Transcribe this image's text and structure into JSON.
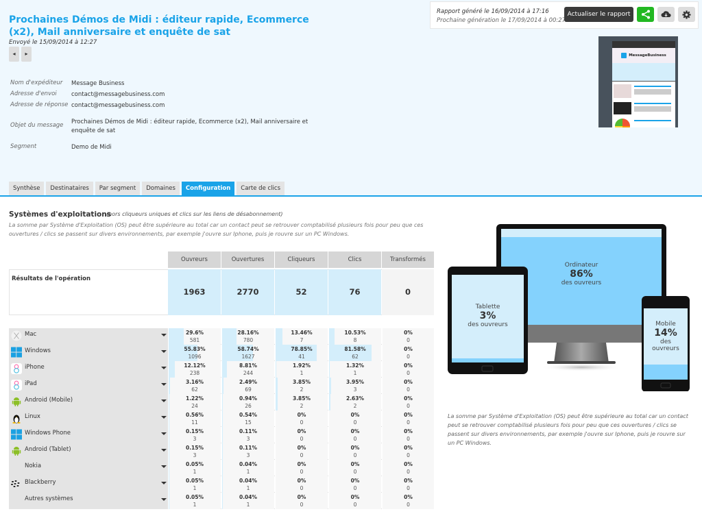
{
  "header": {
    "title": "Prochaines Démos de Midi : éditeur rapide, Ecommerce (x2), Mail anniversaire et enquête de sat",
    "sent": "Envoyé le 15/09/2014 à 12:27",
    "prev_icon": "◂",
    "next_icon": "▸",
    "info": [
      {
        "label": "Nom d'expéditeur",
        "value": "Message Business"
      },
      {
        "label": "Adresse d'envoi",
        "value": "contact@messagebusiness.com"
      },
      {
        "label": "Adresse de réponse",
        "value": "contact@messagebusiness.com"
      },
      {
        "label": "Objet du message",
        "value": "Prochaines Démos de Midi : éditeur rapide, Ecommerce (x2), Mail anniversaire et enquête de sat"
      },
      {
        "label": "Segment",
        "value": "Demo de Midi"
      }
    ]
  },
  "report": {
    "generated": "Rapport généré le 16/09/2014 à 17:16",
    "next": "Prochaine génération le 17/09/2014 à 00:27",
    "refresh_label": "Actualiser le rapport",
    "share_color": "#22b822",
    "thumbnail_brand": "MessageBusiness"
  },
  "tabs": [
    {
      "label": "Synthèse",
      "active": false
    },
    {
      "label": "Destinataires",
      "active": false
    },
    {
      "label": "Par segment",
      "active": false
    },
    {
      "label": "Domaines",
      "active": false
    },
    {
      "label": "Configuration",
      "active": true
    },
    {
      "label": "Carte de clics",
      "active": false
    }
  ],
  "section": {
    "title": "Systèmes d'exploitations",
    "note": "(hors cliqueurs uniques et clics sur les liens de désabonnement)",
    "description": "La somme par Système d'Exploitation (OS) peut être supérieure au total car un contact peut se retrouver comptabilisé plusieurs fois pour peu que ces ouvertures / clics se passent sur divers environnements, par exemple j'ouvre sur Iphone, puis je rouvre sur un PC Windows."
  },
  "table": {
    "columns": [
      "Ouvreurs",
      "Ouvertures",
      "Cliqueurs",
      "Clics",
      "Transformés"
    ],
    "results_label": "Résultats de l'opération",
    "results": [
      "1963",
      "2770",
      "52",
      "76",
      "0"
    ],
    "rows": [
      {
        "name": "Mac",
        "icon": "mac",
        "cells": [
          [
            "29.6%",
            "581"
          ],
          [
            "28.16%",
            "780"
          ],
          [
            "13.46%",
            "7"
          ],
          [
            "10.53%",
            "8"
          ],
          [
            "0%",
            "0"
          ]
        ],
        "fill": [
          0.296,
          0.2816,
          0.1346,
          0.1053,
          0
        ]
      },
      {
        "name": "Windows",
        "icon": "windows",
        "cells": [
          [
            "55.83%",
            "1096"
          ],
          [
            "58.74%",
            "1627"
          ],
          [
            "78.85%",
            "41"
          ],
          [
            "81.58%",
            "62"
          ],
          [
            "0%",
            "0"
          ]
        ],
        "fill": [
          0.5583,
          0.5874,
          0.7885,
          0.8158,
          0
        ]
      },
      {
        "name": "iPhone",
        "icon": "ios",
        "cells": [
          [
            "12.12%",
            "238"
          ],
          [
            "8.81%",
            "244"
          ],
          [
            "1.92%",
            "1"
          ],
          [
            "1.32%",
            "1"
          ],
          [
            "0%",
            "0"
          ]
        ],
        "fill": [
          0.1212,
          0.0881,
          0.0192,
          0.0132,
          0
        ]
      },
      {
        "name": "iPad",
        "icon": "ios",
        "cells": [
          [
            "3.16%",
            "62"
          ],
          [
            "2.49%",
            "69"
          ],
          [
            "3.85%",
            "2"
          ],
          [
            "3.95%",
            "3"
          ],
          [
            "0%",
            "0"
          ]
        ],
        "fill": [
          0.0316,
          0.0249,
          0.0385,
          0.0395,
          0
        ]
      },
      {
        "name": "Android (Mobile)",
        "icon": "android",
        "cells": [
          [
            "1.22%",
            "24"
          ],
          [
            "0.94%",
            "26"
          ],
          [
            "3.85%",
            "2"
          ],
          [
            "2.63%",
            "2"
          ],
          [
            "0%",
            "0"
          ]
        ],
        "fill": [
          0.0122,
          0.0094,
          0.0385,
          0.0263,
          0
        ]
      },
      {
        "name": "Linux",
        "icon": "linux",
        "cells": [
          [
            "0.56%",
            "11"
          ],
          [
            "0.54%",
            "15"
          ],
          [
            "0%",
            "0"
          ],
          [
            "0%",
            "0"
          ],
          [
            "0%",
            "0"
          ]
        ],
        "fill": [
          0.0056,
          0.0054,
          0,
          0,
          0
        ]
      },
      {
        "name": "Windows Phone",
        "icon": "windows",
        "cells": [
          [
            "0.15%",
            "3"
          ],
          [
            "0.11%",
            "3"
          ],
          [
            "0%",
            "0"
          ],
          [
            "0%",
            "0"
          ],
          [
            "0%",
            "0"
          ]
        ],
        "fill": [
          0.0015,
          0.0011,
          0,
          0,
          0
        ]
      },
      {
        "name": "Android (Tablet)",
        "icon": "android",
        "cells": [
          [
            "0.15%",
            "3"
          ],
          [
            "0.11%",
            "3"
          ],
          [
            "0%",
            "0"
          ],
          [
            "0%",
            "0"
          ],
          [
            "0%",
            "0"
          ]
        ],
        "fill": [
          0.0015,
          0.0011,
          0,
          0,
          0
        ]
      },
      {
        "name": "Nokia",
        "icon": "none",
        "cells": [
          [
            "0.05%",
            "1"
          ],
          [
            "0.04%",
            "1"
          ],
          [
            "0%",
            "0"
          ],
          [
            "0%",
            "0"
          ],
          [
            "0%",
            "0"
          ]
        ],
        "fill": [
          0.0005,
          0.0004,
          0,
          0,
          0
        ]
      },
      {
        "name": "Blackberry",
        "icon": "blackberry",
        "cells": [
          [
            "0.05%",
            "1"
          ],
          [
            "0.04%",
            "1"
          ],
          [
            "0%",
            "0"
          ],
          [
            "0%",
            "0"
          ],
          [
            "0%",
            "0"
          ]
        ],
        "fill": [
          0.0005,
          0.0004,
          0,
          0,
          0
        ]
      },
      {
        "name": "Autres systèmes",
        "icon": "none",
        "cells": [
          [
            "0.05%",
            "1"
          ],
          [
            "0.04%",
            "1"
          ],
          [
            "0%",
            "0"
          ],
          [
            "0%",
            "0"
          ],
          [
            "0%",
            "0"
          ]
        ],
        "fill": [
          0.0005,
          0.0004,
          0,
          0,
          0
        ]
      }
    ]
  },
  "devices": {
    "computer": {
      "label": "Ordinateur",
      "value": "86%",
      "sub": "des ouvreurs"
    },
    "tablet": {
      "label": "Tablette",
      "value": "3%",
      "sub": "des ouvreurs"
    },
    "mobile": {
      "label": "Mobile",
      "value": "14%",
      "sub1": "des",
      "sub2": "ouvreurs"
    }
  },
  "side_note": "La somme par Système d'Exploitation (OS) peut être supérieure au total car un contact peut se retrouver comptabilisé plusieurs fois pour peu que ces ouvertures / clics se passent sur divers environnements, par exemple j'ouvre sur Iphone, puis je rouvre sur un PC Windows.",
  "colors": {
    "accent": "#1aa3e8",
    "bar": "#d4eefb",
    "screen": "#84d2fd",
    "screen_light": "#d4eefb"
  }
}
